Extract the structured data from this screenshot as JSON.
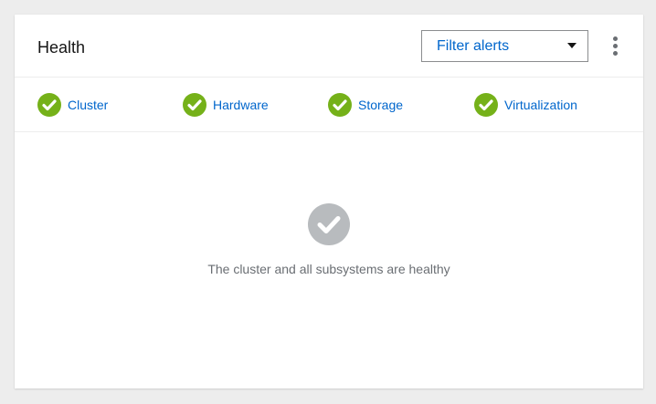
{
  "card": {
    "title": "Health",
    "filter": {
      "selected": "Filter alerts"
    },
    "kebab_icon": "kebab-menu-icon"
  },
  "subsystems": [
    {
      "label": "Cluster",
      "status": "healthy",
      "icon": "check-circle-icon"
    },
    {
      "label": "Hardware",
      "status": "healthy",
      "icon": "check-circle-icon"
    },
    {
      "label": "Storage",
      "status": "healthy",
      "icon": "check-circle-icon"
    },
    {
      "label": "Virtualization",
      "status": "healthy",
      "icon": "check-circle-icon"
    }
  ],
  "empty_state": {
    "icon": "check-circle-icon",
    "message": "The cluster and all subsystems are healthy"
  },
  "colors": {
    "healthy_green": "#75b119",
    "link_blue": "#0066cc",
    "neutral_gray": "#b8bbbe",
    "background": "#ededed"
  }
}
